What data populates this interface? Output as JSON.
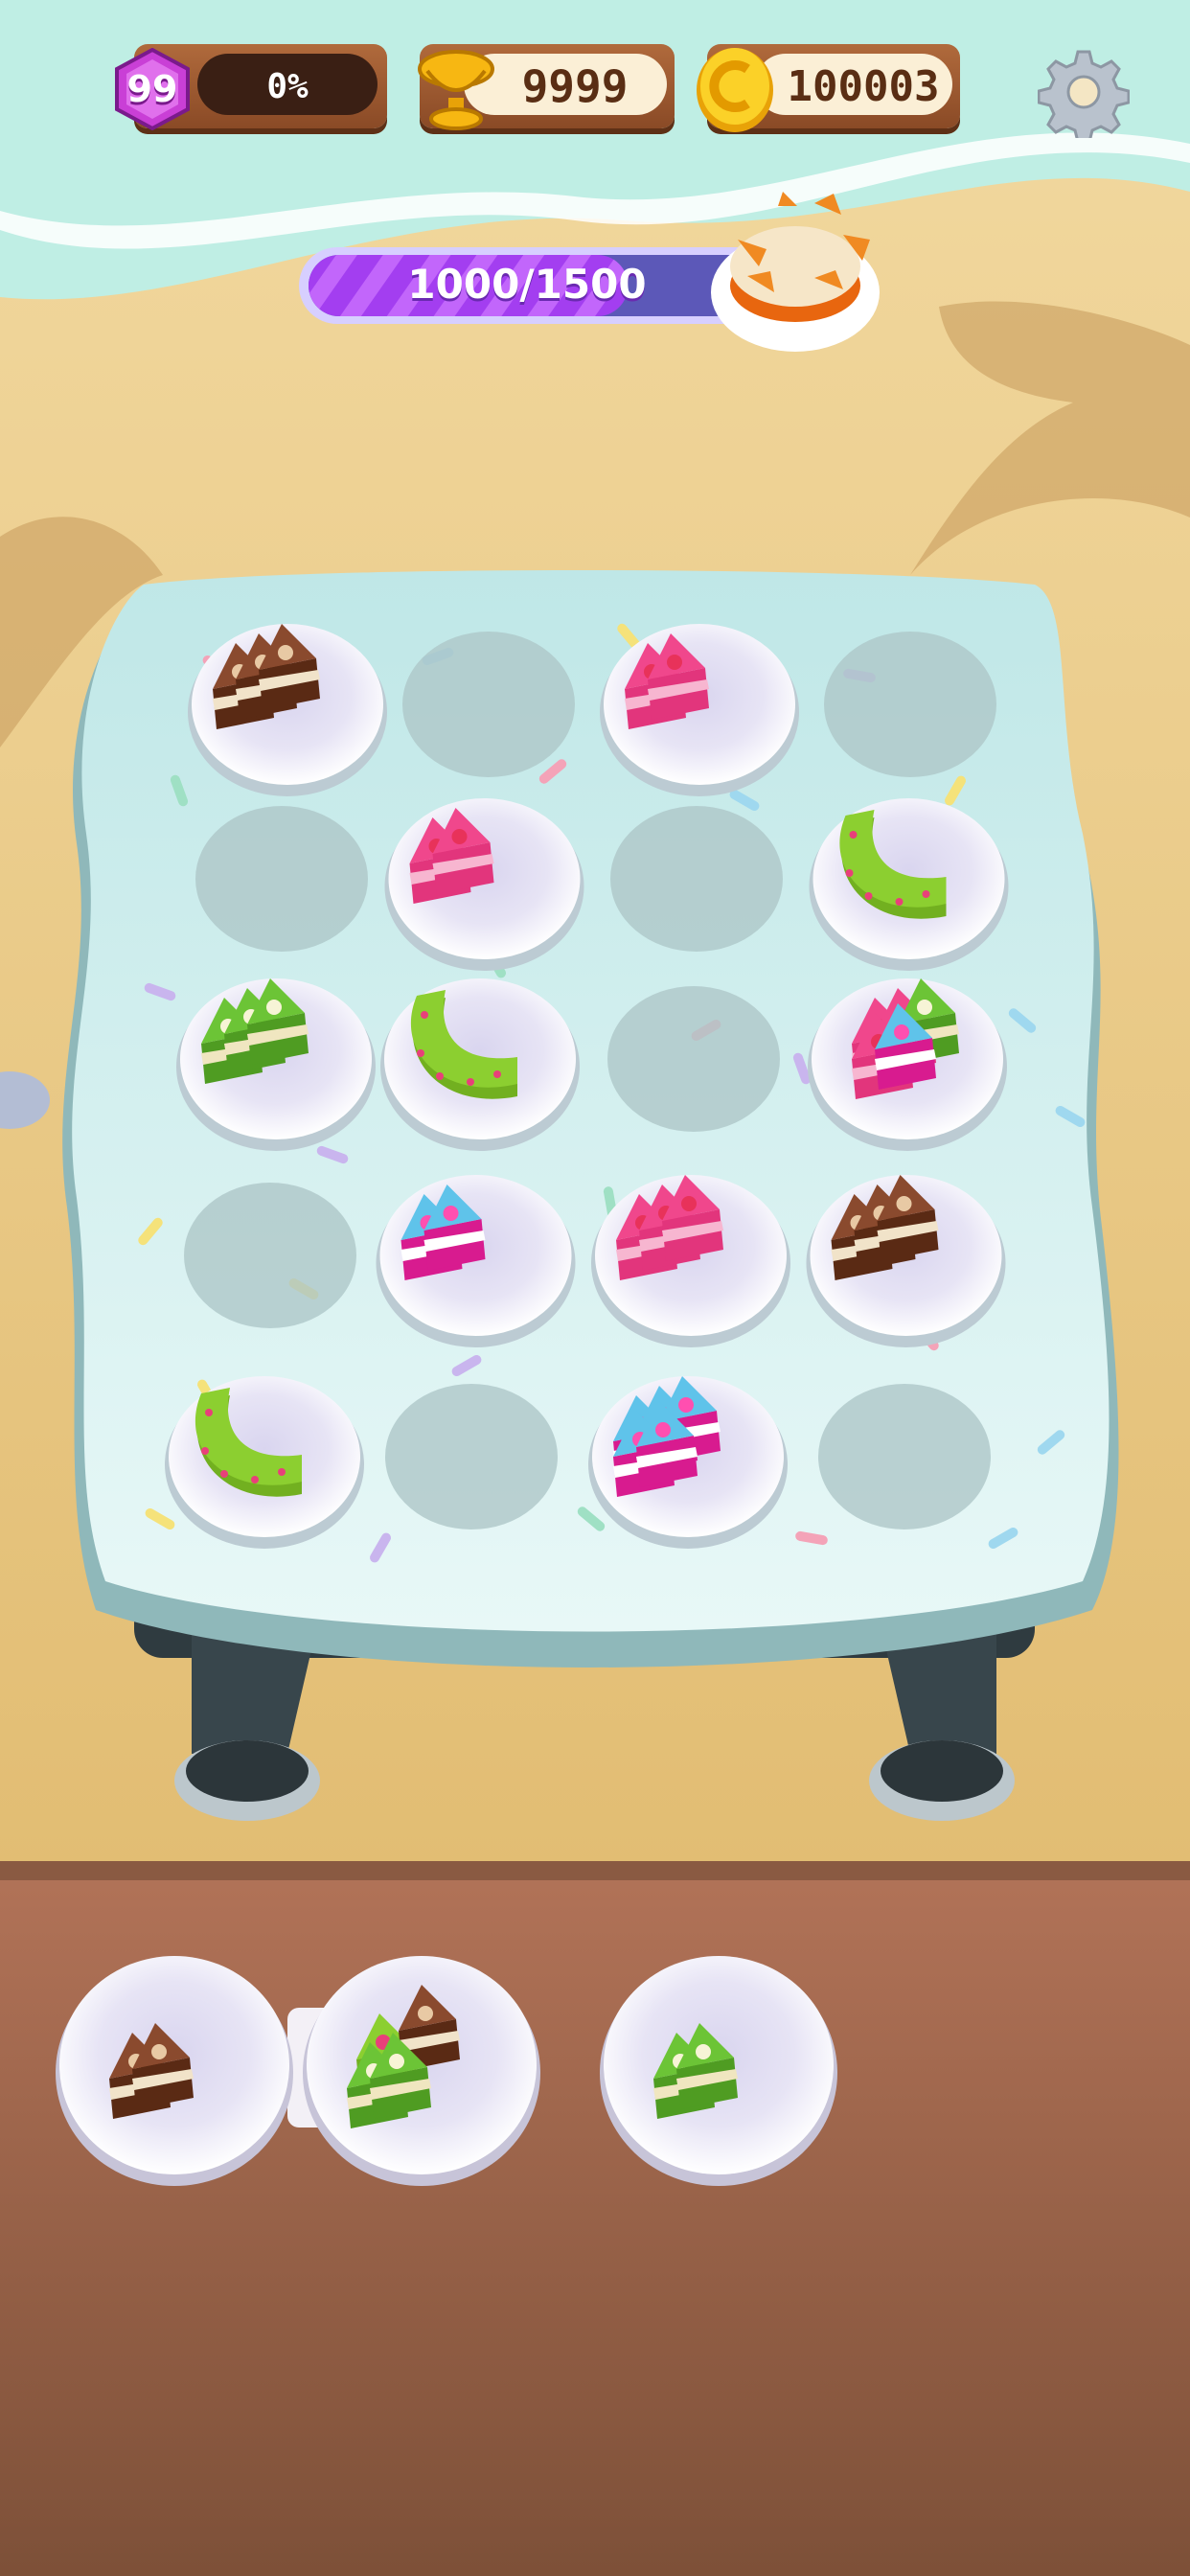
{
  "hud": {
    "level": "99",
    "level_progress": "0%",
    "trophies": "9999",
    "coins": "100003"
  },
  "goal": {
    "progress_label": "1000/1500",
    "progress_fraction": 0.667
  },
  "colors": {
    "hud_wood": "#9c5a30",
    "level_badge": "#c93fd6",
    "progress_purple": "#a23cf0",
    "table_icing": "#c7ecec",
    "counter_wood": "#9c6548"
  },
  "board": {
    "rows": 5,
    "cols": 4,
    "slots": [
      {
        "row": 0,
        "col": 0,
        "cake": "chocolate-hazelnut",
        "slices": 3
      },
      {
        "row": 0,
        "col": 1,
        "cake": null,
        "slices": 0
      },
      {
        "row": 0,
        "col": 2,
        "cake": "strawberry",
        "slices": 2
      },
      {
        "row": 0,
        "col": 3,
        "cake": null,
        "slices": 0
      },
      {
        "row": 1,
        "col": 0,
        "cake": null,
        "slices": 0
      },
      {
        "row": 1,
        "col": 1,
        "cake": "strawberry",
        "slices": 2
      },
      {
        "row": 1,
        "col": 2,
        "cake": null,
        "slices": 0
      },
      {
        "row": 1,
        "col": 3,
        "cake": "matcha-donut",
        "slices": 1
      },
      {
        "row": 2,
        "col": 0,
        "cake": "kiwi",
        "slices": 3
      },
      {
        "row": 2,
        "col": 1,
        "cake": "matcha-donut",
        "slices": 1
      },
      {
        "row": 2,
        "col": 2,
        "cake": null,
        "slices": 0
      },
      {
        "row": 2,
        "col": 3,
        "cake": "mixed",
        "slices": 5
      },
      {
        "row": 3,
        "col": 0,
        "cake": null,
        "slices": 0
      },
      {
        "row": 3,
        "col": 1,
        "cake": "blueberry-cupcake",
        "slices": 2
      },
      {
        "row": 3,
        "col": 2,
        "cake": "strawberry",
        "slices": 3
      },
      {
        "row": 3,
        "col": 3,
        "cake": "chocolate-hazelnut",
        "slices": 3
      },
      {
        "row": 4,
        "col": 0,
        "cake": "matcha-donut",
        "slices": 1
      },
      {
        "row": 4,
        "col": 1,
        "cake": null,
        "slices": 0
      },
      {
        "row": 4,
        "col": 2,
        "cake": "blueberry-cupcake",
        "slices": 5
      },
      {
        "row": 4,
        "col": 3,
        "cake": null,
        "slices": 0
      }
    ]
  },
  "tray": [
    {
      "cake": "chocolate-hazelnut",
      "slices": 2
    },
    {
      "cake": "kiwi-mixed",
      "slices": 4
    },
    {
      "cake": "kiwi",
      "slices": 2
    }
  ],
  "icons": [
    "level-badge-icon",
    "trophy-icon",
    "coin-icon",
    "settings-gear-icon",
    "goal-cake-icon"
  ]
}
